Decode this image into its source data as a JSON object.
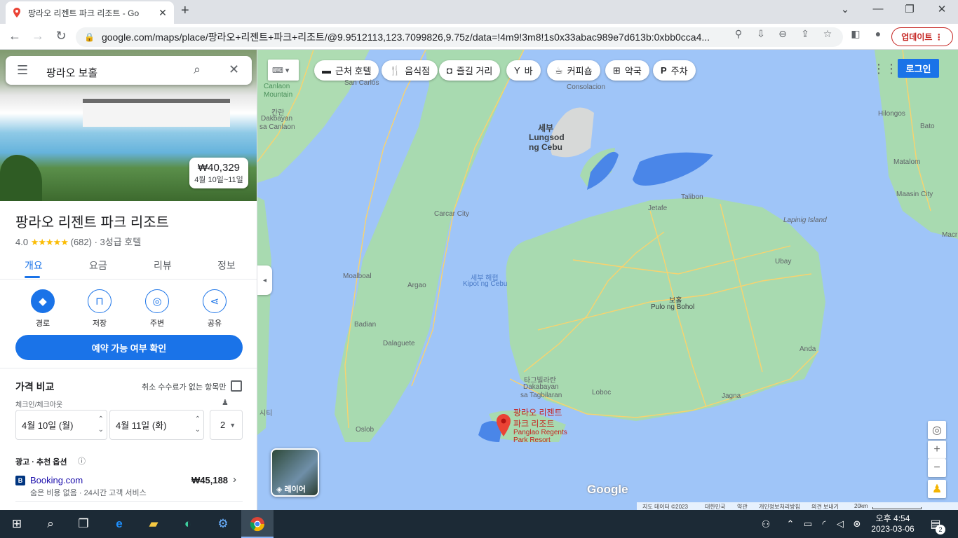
{
  "browser": {
    "tab_title": "팡라오 리젠트 파크 리조트 - Go",
    "url": "google.com/maps/place/팡라오+리젠트+파크+리조트/@9.9512113,123.7099826,9.75z/data=!4m9!3m8!1s0x33abac989e7d613b:0xbb0cca4...",
    "update_label": "업데이트"
  },
  "panel": {
    "search_value": "팡라오 보홀",
    "price": "₩40,329",
    "price_dates": "4월 10일~11일",
    "place_name": "팡라오 리젠트 파크 리조트",
    "rating": "4.0",
    "stars": "★★★★★",
    "review_count": "(682)",
    "category": "· 3성급 호텔",
    "tabs": [
      "개요",
      "요금",
      "리뷰",
      "정보"
    ],
    "actions": [
      "경로",
      "저장",
      "주변",
      "공유"
    ],
    "book_button": "예약 가능 여부 확인",
    "compare_title": "가격 비교",
    "free_cancel": "취소 수수료가 없는 항목만",
    "checkin_label": "체크인/체크아웃",
    "checkin": "4월 10일 (월)",
    "checkout": "4월 11일 (화)",
    "guests": "2",
    "ad_label": "광고 · 추천 옵션",
    "booking_name": "Booking.com",
    "booking_note": "숨은 비용 없음 · 24시간 고객 서비스",
    "booking_price": "₩45,188"
  },
  "map": {
    "chips": [
      "근처 호텔",
      "음식점",
      "즐길 거리",
      "바",
      "커피숍",
      "약국",
      "주차"
    ],
    "login": "로그인",
    "layer_label": "레이어",
    "pin_label_ko1": "팡라오 리젠트",
    "pin_label_ko2": "파크 리조트",
    "pin_label_en1": "Panglao Regents",
    "pin_label_en2": "Park Resort",
    "places": {
      "cebu_ko": "세부",
      "cebu1": "Lungsod",
      "cebu2": "ng Cebu",
      "consolacion": "Consolacion",
      "carcar": "Carcar City",
      "moalboal": "Moalboal",
      "argao": "Argao",
      "badian": "Badian",
      "dalaguete": "Dalaguete",
      "oslob": "Oslob",
      "sea_ko": "세부 해협",
      "sea_en": "Kipot ng Cebu",
      "talibon": "Talibon",
      "jetafe": "Jetafe",
      "ubay": "Ubay",
      "bohol_ko": "보홀",
      "bohol_en": "Pulo ng Bohol",
      "anda": "Anda",
      "jagna": "Jagna",
      "loboc": "Loboc",
      "tag_ko": "타그빌라란",
      "tag1": "Dakabayan",
      "tag2": "sa Tagbilaran",
      "hilongos": "Hilongos",
      "bato": "Bato",
      "matalom": "Matalom",
      "maasin": "Maasin City",
      "lapinig": "Lapinig Island",
      "canlaon_en1": "Canlaon",
      "canlaon_en2": "Mountain",
      "kanlaon_ko": "칸란",
      "canlaon_city1": "Dakbayan",
      "canlaon_city2": "sa Canlaon",
      "sancarlos": "San Carlos",
      "macr": "Macr",
      "sisi": "시티"
    },
    "footer": [
      "지도 데이터 ©2023",
      "대한민국",
      "약관",
      "개인정보처리방침",
      "의견 보내기",
      "20km"
    ]
  },
  "taskbar": {
    "time": "오후 4:54",
    "date": "2023-03-06",
    "notif": "2"
  }
}
